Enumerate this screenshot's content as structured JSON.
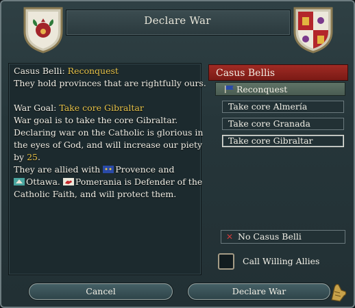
{
  "window": {
    "title": "Declare War"
  },
  "description": {
    "cb_label": "Casus Belli:",
    "cb_value": "Reconquest",
    "cb_text": "They hold provinces that are rightfully ours.",
    "goal_label": "War Goal:",
    "goal_value": "Take core Gibraltar",
    "goal_text": "War goal is to take the core Gibraltar. Declaring war on the Catholic is glorious in the eyes of God, and will increase our piety by",
    "piety_value": "25",
    "period": ".",
    "allied_prefix": "They are allied with",
    "ally_1": "Provence and",
    "ally_2": "Ottawa.",
    "defender_name": "Pomerania",
    "defender_text": "is Defender of the Catholic Faith, and will protect them."
  },
  "casus_bellis": {
    "header": "Casus Bellis",
    "selected": "Reconquest",
    "goals": [
      "Take core Almería",
      "Take core Granada",
      "Take core Gibraltar"
    ],
    "no_cb": "No Casus Belli"
  },
  "options": {
    "call_allies": "Call Willing Allies",
    "call_allies_checked": false
  },
  "buttons": {
    "cancel": "Cancel",
    "declare": "Declare War"
  },
  "colors": {
    "highlight": "#e8c44a",
    "header_red": "#a02b24",
    "panel": "#1c2a2e"
  },
  "icons": [
    "pomegranate-shield-icon",
    "castile-leon-shield-icon",
    "flag-icon",
    "no-cb-x-icon",
    "gauntlet-icon"
  ]
}
